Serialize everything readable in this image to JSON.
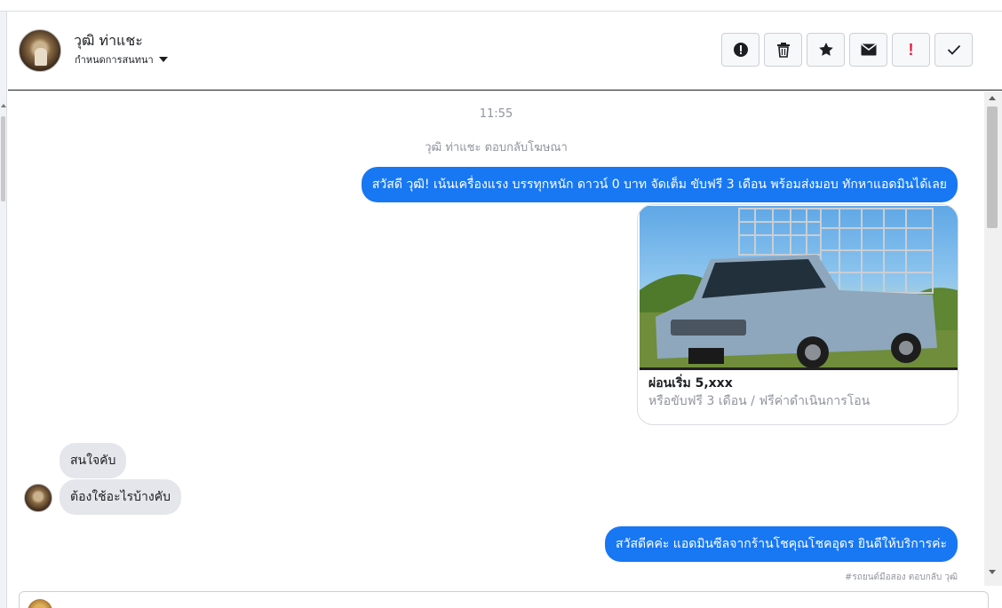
{
  "header": {
    "contact_name": "วุฒิ ท่าแชะ",
    "sub_label": "กำหนดการสนทนา",
    "actions": [
      {
        "name": "report-icon",
        "label": "!"
      },
      {
        "name": "trash-icon",
        "label": ""
      },
      {
        "name": "star-icon",
        "label": ""
      },
      {
        "name": "envelope-icon",
        "label": ""
      },
      {
        "name": "important-icon",
        "label": "!"
      },
      {
        "name": "checkmark-icon",
        "label": ""
      }
    ]
  },
  "chat": {
    "timestamp": "11:55",
    "ad_reply_note": "วุฒิ ท่าแชะ ตอบกลับโฆษณา",
    "messages": [
      {
        "from": "page",
        "text": "สวัสดี วุฒิ! เน้นเครื่องแรง บรรทุกหนัก ดาวน์ 0 บาท จัดเต็ม ขับฟรี 3 เดือน พร้อมส่งมอบ ทักหาแอดมินได้เลย"
      },
      {
        "from": "user",
        "text": "สนใจคับ"
      },
      {
        "from": "user",
        "text": "ต้องใช้อะไรบ้างคับ"
      },
      {
        "from": "page",
        "text": "สวัสดีคค่ะ แอดมินซีลจากร้านโชคุณโชคอุดร ยินดีให้บริการค่ะ"
      }
    ],
    "ad_card": {
      "title": "ผ่อนเริ่ม 5,xxx",
      "description": "หรือขับฟรี 3 เดือน / ฟรีค่าดำเนินการโอน",
      "image": "pickup-truck-with-cage-photo"
    },
    "footer_note": "#รถยนต์มือสอง ตอบกลับ วุฒิ"
  },
  "colors": {
    "outgoing": "#1877f2",
    "incoming": "#e4e6eb",
    "danger": "#e41e3f"
  }
}
